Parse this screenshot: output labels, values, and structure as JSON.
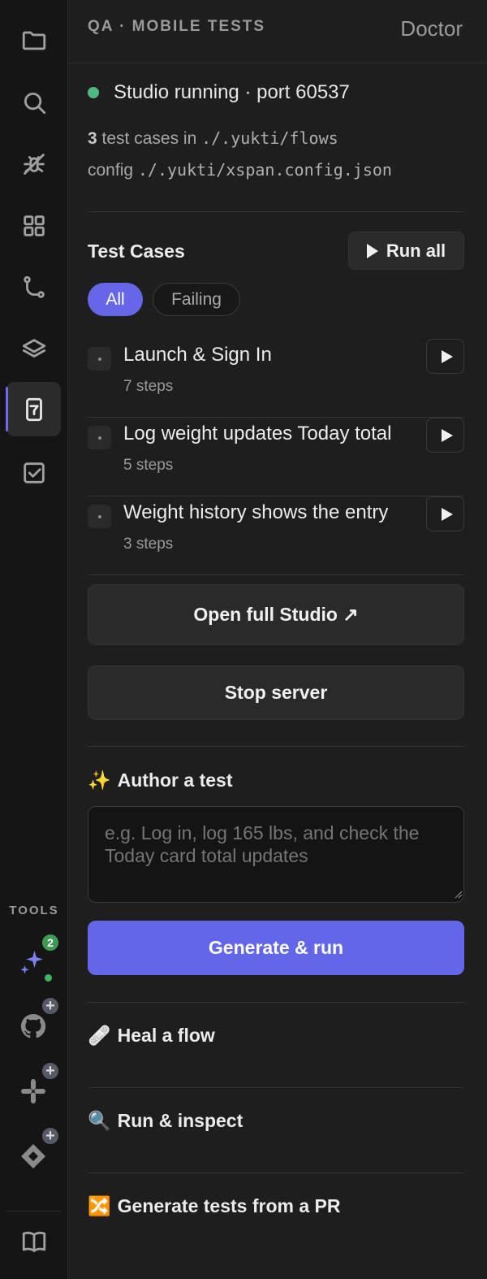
{
  "activity": {
    "icons": [
      "folder-icon",
      "search-icon",
      "debug-icon",
      "extensions-icon",
      "source-control-icon",
      "layers-icon",
      "mobile-test-icon",
      "checklist-icon"
    ],
    "tools_label": "TOOLS",
    "tools": [
      {
        "name": "ai-sparkles-icon",
        "badge": "2"
      },
      {
        "name": "github-icon",
        "badge": "+"
      },
      {
        "name": "slack-icon",
        "badge": "+"
      },
      {
        "name": "jira-icon",
        "badge": "+"
      }
    ],
    "bottom_icon": "book-icon"
  },
  "header": {
    "title": "QA · MOBILE TESTS",
    "link": "Doctor"
  },
  "status": {
    "text": "Studio running · port 60537",
    "color": "#4fb87e"
  },
  "info": {
    "count": "3",
    "cases_text": " test cases in ",
    "flows_path": "./.yukti/flows",
    "config_label": "config ",
    "config_path": "./.yukti/xspan.config.json"
  },
  "test_cases": {
    "title": "Test Cases",
    "run_all_label": "Run all",
    "filters": [
      "All",
      "Failing"
    ],
    "items": [
      {
        "name": "Launch & Sign In",
        "steps": "7 steps"
      },
      {
        "name": "Log weight updates Today total",
        "steps": "5 steps"
      },
      {
        "name": "Weight history shows the entry",
        "steps": "3 steps"
      }
    ]
  },
  "actions": {
    "open_studio": "Open full Studio ↗",
    "stop_server": "Stop server"
  },
  "author": {
    "emoji": "✨",
    "title": "Author a test",
    "placeholder": "e.g. Log in, log 165 lbs, and check the Today card total updates",
    "generate_label": "Generate & run"
  },
  "sections": [
    {
      "emoji": "🩹",
      "title": "Heal a flow"
    },
    {
      "emoji": "🔍",
      "title": "Run & inspect"
    },
    {
      "emoji": "🔀",
      "title": "Generate tests from a PR"
    }
  ],
  "colors": {
    "accent": "#6366e8",
    "status_green": "#4fb87e",
    "badge_green": "#3d9a50"
  }
}
